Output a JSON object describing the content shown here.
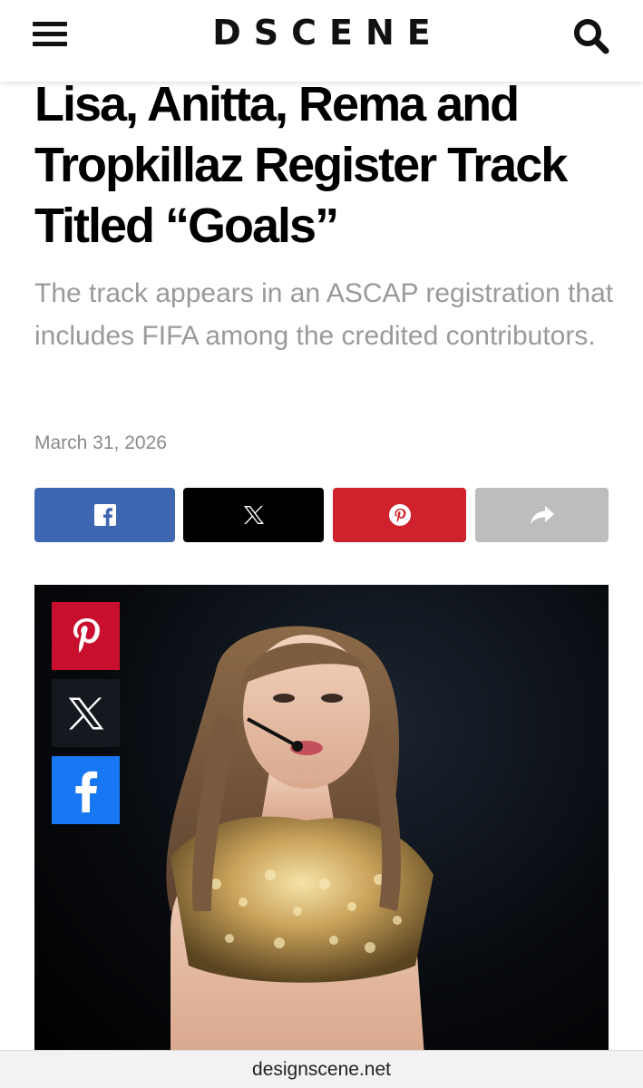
{
  "header": {
    "logo": "DSCENE",
    "menu_icon": "hamburger-menu-icon",
    "search_icon": "search-icon"
  },
  "article": {
    "title": "Lisa, Anitta, Rema and Tropkillaz Register Track Titled “Goals”",
    "subtitle": "The track appears in an ASCAP registration that includes FIFA among the credited contributors.",
    "date": "March 31, 2026"
  },
  "share_bar": [
    {
      "name": "facebook",
      "icon": "facebook-icon",
      "color": "#3f66b0"
    },
    {
      "name": "x",
      "icon": "x-icon",
      "color": "#000000"
    },
    {
      "name": "pinterest",
      "icon": "pinterest-icon",
      "color": "#d0222d"
    },
    {
      "name": "more",
      "icon": "share-arrow-icon",
      "color": "#bdbdbd"
    }
  ],
  "floating_share": [
    {
      "name": "pinterest",
      "icon": "pinterest-icon",
      "color": "#c8102e"
    },
    {
      "name": "x",
      "icon": "x-icon",
      "color": "#15191f"
    },
    {
      "name": "facebook",
      "icon": "facebook-icon",
      "color": "#1877f2"
    }
  ],
  "browser": {
    "url": "designscene.net"
  }
}
